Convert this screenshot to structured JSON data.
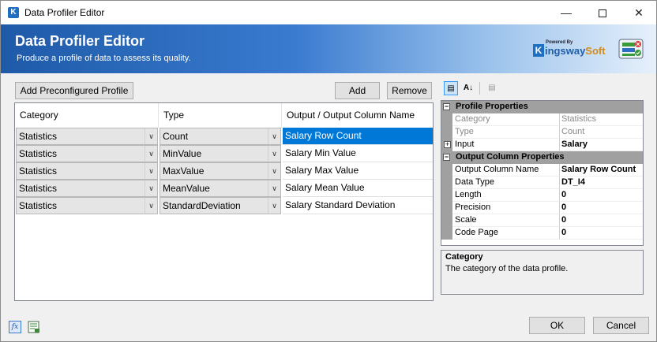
{
  "window": {
    "title": "Data Profiler Editor"
  },
  "header": {
    "title": "Data Profiler Editor",
    "subtitle": "Produce a profile of data to assess its quality.",
    "logo_powered": "Powered By",
    "logo_initial": "K",
    "logo_name_main": "ingsway",
    "logo_name_accent": "Soft"
  },
  "toolbar": {
    "add_preconfigured": "Add Preconfigured Profile",
    "add": "Add",
    "remove": "Remove"
  },
  "grid": {
    "columns": [
      "Category",
      "Type",
      "Output / Output Column Name"
    ],
    "rows": [
      {
        "category": "Statistics",
        "type": "Count",
        "output": "Salary Row Count",
        "selected": true
      },
      {
        "category": "Statistics",
        "type": "MinValue",
        "output": "Salary Min Value"
      },
      {
        "category": "Statistics",
        "type": "MaxValue",
        "output": "Salary Max Value"
      },
      {
        "category": "Statistics",
        "type": "MeanValue",
        "output": "Salary Mean Value"
      },
      {
        "category": "Statistics",
        "type": "StandardDeviation",
        "output": "Salary Standard Deviation"
      }
    ]
  },
  "propgrid": {
    "toolbar_icons": [
      "categorized-icon",
      "alphabetical-icon",
      "property-pages-icon"
    ],
    "section1": {
      "title": "Profile Properties",
      "rows": [
        {
          "name": "Category",
          "value": "Statistics"
        },
        {
          "name": "Type",
          "value": "Count"
        },
        {
          "name": "Input",
          "value": "Salary"
        }
      ]
    },
    "section2": {
      "title": "Output Column Properties",
      "rows": [
        {
          "name": "Output Column Name",
          "value": "Salary Row Count"
        },
        {
          "name": "Data Type",
          "value": "DT_I4"
        },
        {
          "name": "Length",
          "value": "0"
        },
        {
          "name": "Precision",
          "value": "0"
        },
        {
          "name": "Scale",
          "value": "0"
        },
        {
          "name": "Code Page",
          "value": "0"
        }
      ]
    },
    "description": {
      "title": "Category",
      "text": "The category of the data profile."
    }
  },
  "footer": {
    "fx_label": "fx",
    "ok": "OK",
    "cancel": "Cancel"
  },
  "colors": {
    "selection": "#0078d7",
    "header_start": "#1e5aa8",
    "category_bar": "#a0a0a0"
  }
}
